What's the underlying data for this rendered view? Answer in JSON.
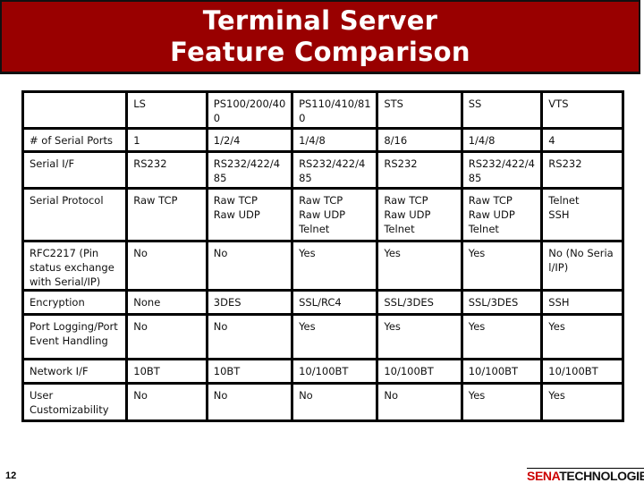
{
  "title": {
    "line1": "Terminal Server",
    "line2": "Feature Comparison"
  },
  "table": {
    "headers": [
      "",
      "LS",
      "PS100/200/400",
      "PS110/410/810",
      "STS",
      "SS",
      "VTS"
    ],
    "rows": [
      {
        "feature": "# of Serial Ports",
        "values": [
          "1",
          "1/2/4",
          "1/4/8",
          "8/16",
          "1/4/8",
          "4"
        ]
      },
      {
        "feature": "Serial I/F",
        "values": [
          "RS232",
          "RS232/422/485",
          "RS232/422/485",
          "RS232",
          "RS232/422/485",
          "RS232"
        ]
      },
      {
        "feature": "Serial Protocol",
        "values": [
          "Raw TCP",
          "Raw TCP\nRaw UDP",
          "Raw TCP\nRaw UDP\nTelnet",
          "Raw TCP\nRaw UDP\nTelnet",
          "Raw TCP\nRaw UDP\nTelnet",
          "Telnet\nSSH"
        ]
      },
      {
        "feature": "RFC2217 (Pin status exchange with Serial/IP)",
        "values": [
          "No",
          "No",
          "Yes",
          "Yes",
          "Yes",
          "No (No Serial/IP)"
        ]
      },
      {
        "feature": "Encryption",
        "values": [
          "None",
          "3DES",
          "SSL/RC4",
          "SSL/3DES",
          "SSL/3DES",
          "SSH"
        ]
      },
      {
        "feature": "Port Logging/Port Event Handling",
        "values": [
          "No",
          "No",
          "Yes",
          "Yes",
          "Yes",
          "Yes"
        ]
      },
      {
        "feature": "Network I/F",
        "values": [
          "10BT",
          "10BT",
          "10/100BT",
          "10/100BT",
          "10/100BT",
          "10/100BT"
        ]
      },
      {
        "feature": "User Customizability",
        "values": [
          "No",
          "No",
          "No",
          "No",
          "Yes",
          "Yes"
        ]
      }
    ]
  },
  "footer": {
    "page_number": "12",
    "logo_brand": "SENA",
    "logo_suffix": "TECHNOLOGIES"
  },
  "colors": {
    "banner": "#990000",
    "logo_red": "#cc0000"
  }
}
